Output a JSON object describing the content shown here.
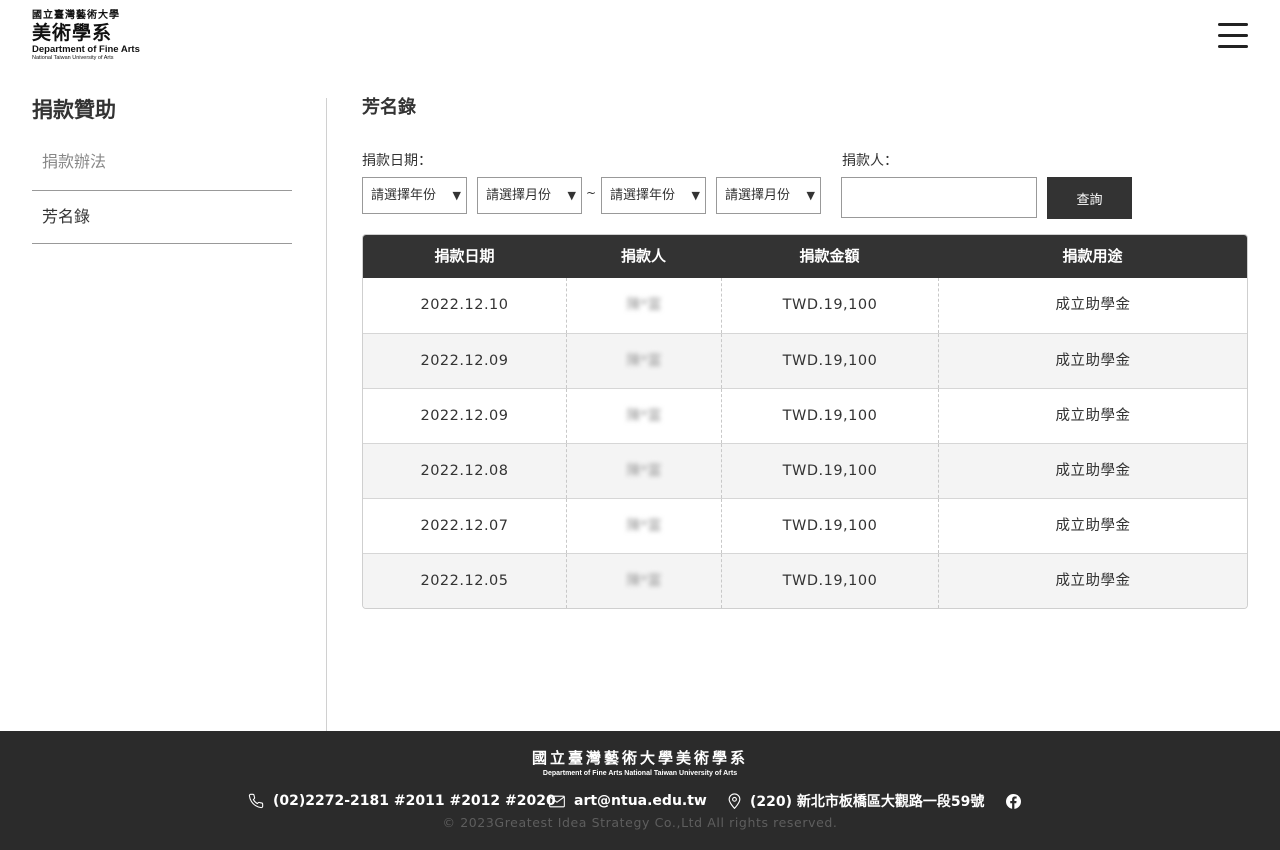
{
  "header": {
    "logo": {
      "line1": "國立臺灣藝術大學",
      "line2": "美術學系",
      "line3": "Department of Fine Arts",
      "line4": "National Taiwan University of Arts"
    },
    "menu_icon": "hamburger-icon"
  },
  "sidebar": {
    "title": "捐款贊助",
    "items": [
      {
        "label": "捐款辦法",
        "active": false
      },
      {
        "label": "芳名錄",
        "active": true
      }
    ]
  },
  "main": {
    "title": "芳名錄",
    "filters": {
      "date_label": "捐款日期：",
      "start_year": "請選擇年份",
      "start_month": "請選擇月份",
      "range_separator": "~",
      "end_year": "請選擇年份",
      "end_month": "請選擇月份",
      "arrow": "▼",
      "donor_label": "捐款人：",
      "donor_value": "",
      "query_label": "查詢"
    },
    "table": {
      "headers": [
        "捐款日期",
        "捐款人",
        "捐款金額",
        "捐款用途"
      ],
      "rows": [
        {
          "date": "2022.12.10",
          "donor": "陳*富",
          "amount": "TWD.19,100",
          "purpose": "成立助學金"
        },
        {
          "date": "2022.12.09",
          "donor": "陳*富",
          "amount": "TWD.19,100",
          "purpose": "成立助學金"
        },
        {
          "date": "2022.12.09",
          "donor": "陳*富",
          "amount": "TWD.19,100",
          "purpose": "成立助學金"
        },
        {
          "date": "2022.12.08",
          "donor": "陳*富",
          "amount": "TWD.19,100",
          "purpose": "成立助學金"
        },
        {
          "date": "2022.12.07",
          "donor": "陳*富",
          "amount": "TWD.19,100",
          "purpose": "成立助學金"
        },
        {
          "date": "2022.12.05",
          "donor": "陳*富",
          "amount": "TWD.19,100",
          "purpose": "成立助學金"
        }
      ]
    }
  },
  "footer": {
    "logo_cn": "國立臺灣藝術大學美術學系",
    "logo_en": "Department of Fine Arts  National Taiwan University of  Arts",
    "phone": "(02)2272-2181 #2011 #2012 #2020",
    "email": "art@ntua.edu.tw",
    "address": "(220) 新北市板橋區大觀路一段59號",
    "social_icon": "facebook-icon",
    "copyright": "© 2023Greatest Idea Strategy Co.,Ltd All rights reserved."
  },
  "colors": {
    "dark": "#333333",
    "footer_bg": "#2b2b2b",
    "stripe": "#f4f4f4"
  }
}
